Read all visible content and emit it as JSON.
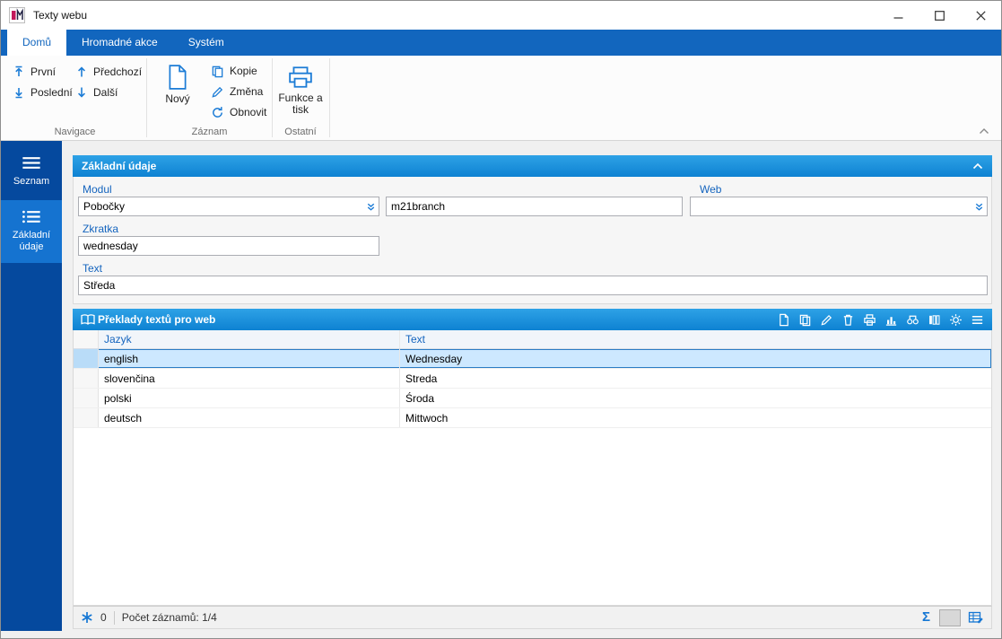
{
  "window": {
    "title": "Texty webu"
  },
  "ribbon": {
    "tabs": [
      {
        "label": "Domů"
      },
      {
        "label": "Hromadné akce"
      },
      {
        "label": "Systém"
      }
    ],
    "nav": {
      "first": "První",
      "last": "Poslední",
      "prev": "Předchozí",
      "next": "Další",
      "group": "Navigace"
    },
    "record": {
      "new": "Nový",
      "copy": "Kopie",
      "change": "Změna",
      "refresh": "Obnovit",
      "group": "Záznam"
    },
    "other": {
      "funkce": "Funkce a tisk",
      "group": "Ostatní"
    }
  },
  "sidebar": {
    "items": [
      {
        "label": "Seznam"
      },
      {
        "label": "Základní údaje"
      }
    ]
  },
  "form": {
    "title": "Základní údaje",
    "modul_label": "Modul",
    "modul_value": "Pobočky",
    "code_value": "m21branch",
    "web_label": "Web",
    "web_value": "",
    "zkratka_label": "Zkratka",
    "zkratka_value": "wednesday",
    "text_label": "Text",
    "text_value": "Středa"
  },
  "grid": {
    "title": "Překlady textů pro web",
    "columns": [
      "Jazyk",
      "Text"
    ],
    "rows": [
      {
        "jazyk": "english",
        "text": "Wednesday"
      },
      {
        "jazyk": "slovenčina",
        "text": "Streda"
      },
      {
        "jazyk": "polski",
        "text": "Środa"
      },
      {
        "jazyk": "deutsch",
        "text": "Mittwoch"
      }
    ]
  },
  "statusbar": {
    "flag_count": "0",
    "records": "Počet záznamů: 1/4",
    "sum_icon": "Σ"
  },
  "colors": {
    "ribbon_blue": "#1266BE",
    "sidebar_blue": "#05499E",
    "sidebar_active": "#1573D0",
    "panel_header": "#1690DC",
    "label_blue": "#1464BE",
    "selected_row": "#CDE8FF"
  }
}
